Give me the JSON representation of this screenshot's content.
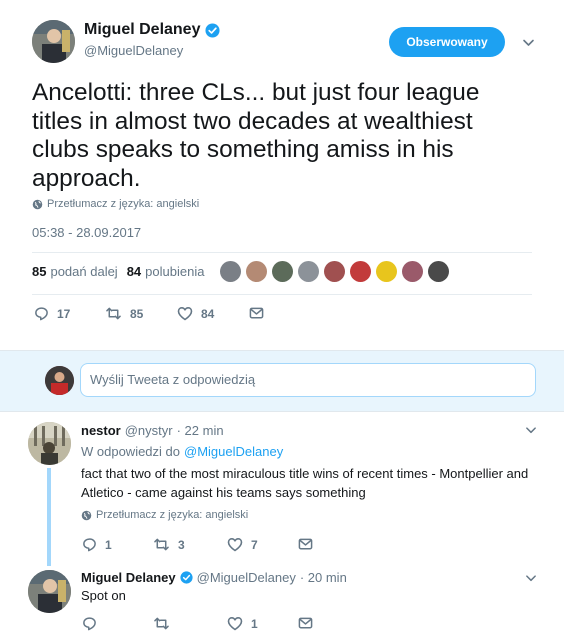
{
  "main_tweet": {
    "author_name": "Miguel Delaney",
    "author_handle": "@MiguelDelaney",
    "follow_button_label": "Obserwowany",
    "text": "Ancelotti: three CLs... but just four league titles in almost two decades at wealthiest clubs speaks to something amiss in his approach.",
    "translate_label": "Przetłumacz z języka: angielski",
    "timestamp": "05:38 - 28.09.2017",
    "retweets_count": "85",
    "retweets_label": "podań dalej",
    "likes_count": "84",
    "likes_label": "polubienia",
    "actions": {
      "replies": "17",
      "retweets": "85",
      "likes": "84"
    }
  },
  "reply_box": {
    "placeholder": "Wyślij Tweeta z odpowiedzią"
  },
  "replies": [
    {
      "author_name": "nestor",
      "author_handle": "@nystyr",
      "time": "· 22 min",
      "in_reply_to_prefix": "W odpowiedzi do",
      "in_reply_to_handle": "@MiguelDelaney",
      "text": "fact that two of the most miraculous title wins of recent times - Montpellier and Atletico - came against his teams says something",
      "translate_label": "Przetłumacz z języka: angielski",
      "actions": {
        "replies": "1",
        "retweets": "3",
        "likes": "7"
      }
    },
    {
      "author_name": "Miguel Delaney",
      "author_handle": "@MiguelDelaney",
      "time": "· 20 min",
      "text": "Spot on",
      "actions": {
        "replies": "",
        "retweets": "",
        "likes": "1"
      }
    }
  ],
  "colors": {
    "accent": "#1da1f2",
    "muted": "#657786",
    "divider": "#e6ecf0",
    "thread_line": "#a3d7fb"
  }
}
